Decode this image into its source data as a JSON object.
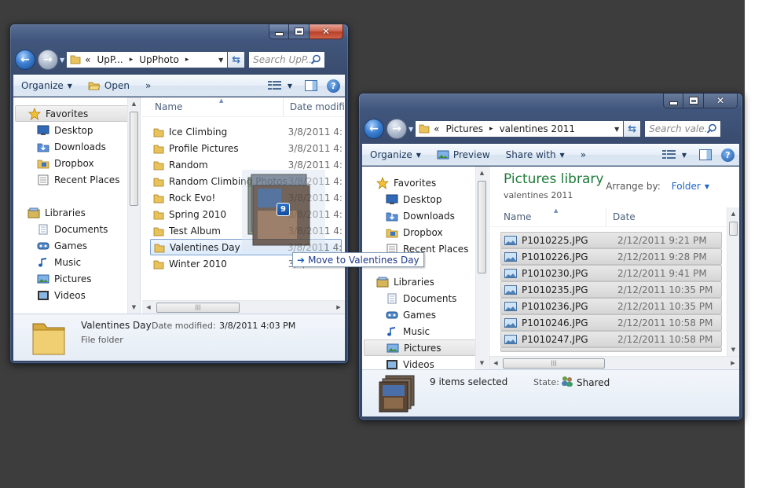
{
  "left_window": {
    "address_crumbs": [
      "«",
      "UpP...",
      "UpPhoto"
    ],
    "search_placeholder": "Search UpP...",
    "toolbar": {
      "organize": "Organize",
      "open": "Open",
      "more": "»"
    },
    "nav": {
      "favorites_label": "Favorites",
      "favorites": [
        "Desktop",
        "Downloads",
        "Dropbox",
        "Recent Places"
      ],
      "libraries_label": "Libraries",
      "libraries": [
        "Documents",
        "Games",
        "Music",
        "Pictures",
        "Videos"
      ]
    },
    "columns": {
      "name": "Name",
      "date": "Date modifi"
    },
    "folders": [
      {
        "name": "Ice Climbing",
        "date": "3/8/2011 4:"
      },
      {
        "name": "Profile Pictures",
        "date": "3/8/2011 4:"
      },
      {
        "name": "Random",
        "date": "3/8/2011 4:"
      },
      {
        "name": "Random Climbing Photos",
        "date": "3/8/2011 4:"
      },
      {
        "name": "Rock Evo!",
        "date": "3/8/2011 4:"
      },
      {
        "name": "Spring 2010",
        "date": "3/8/2011 4:"
      },
      {
        "name": "Test Album",
        "date": "3/8/2011 4:"
      },
      {
        "name": "Valentines Day",
        "date": "3/8/2011 4:"
      },
      {
        "name": "Winter 2010",
        "date": "3/8/2011 4:"
      }
    ],
    "details": {
      "name": "Valentines Day",
      "date_label": "Date modified:",
      "date_value": "3/8/2011 4:03 PM",
      "type": "File folder"
    }
  },
  "drag": {
    "count": "9",
    "tooltip": "Move to Valentines Day"
  },
  "right_window": {
    "address_crumbs": [
      "«",
      "Pictures",
      "valentines 2011"
    ],
    "search_placeholder": "Search vale...",
    "toolbar": {
      "organize": "Organize",
      "preview": "Preview",
      "share_with": "Share with",
      "more": "»"
    },
    "nav": {
      "favorites_label": "Favorites",
      "favorites": [
        "Desktop",
        "Downloads",
        "Dropbox",
        "Recent Places"
      ],
      "libraries_label": "Libraries",
      "libraries": [
        "Documents",
        "Games",
        "Music",
        "Pictures",
        "Videos"
      ]
    },
    "library": {
      "title": "Pictures library",
      "subtitle": "valentines 2011",
      "arrange_label": "Arrange by:",
      "arrange_value": "Folder"
    },
    "columns": {
      "name": "Name",
      "date": "Date"
    },
    "files": [
      {
        "name": "P1010225.JPG",
        "date": "2/12/2011 9:21 PM"
      },
      {
        "name": "P1010226.JPG",
        "date": "2/12/2011 9:28 PM"
      },
      {
        "name": "P1010230.JPG",
        "date": "2/12/2011 9:41 PM"
      },
      {
        "name": "P1010235.JPG",
        "date": "2/12/2011 10:35 PM"
      },
      {
        "name": "P1010236.JPG",
        "date": "2/12/2011 10:35 PM"
      },
      {
        "name": "P1010246.JPG",
        "date": "2/12/2011 10:58 PM"
      },
      {
        "name": "P1010247.JPG",
        "date": "2/12/2011 10:58 PM"
      }
    ],
    "details": {
      "selected": "9 items selected",
      "state_label": "State:",
      "state_value": "Shared"
    }
  },
  "colors": {
    "chrome": "#41567c",
    "toolbar_text": "#1e395b",
    "library_title": "#1e7b3a",
    "link_blue": "#1e66c8",
    "folder_yellow": "#e8c25a"
  }
}
